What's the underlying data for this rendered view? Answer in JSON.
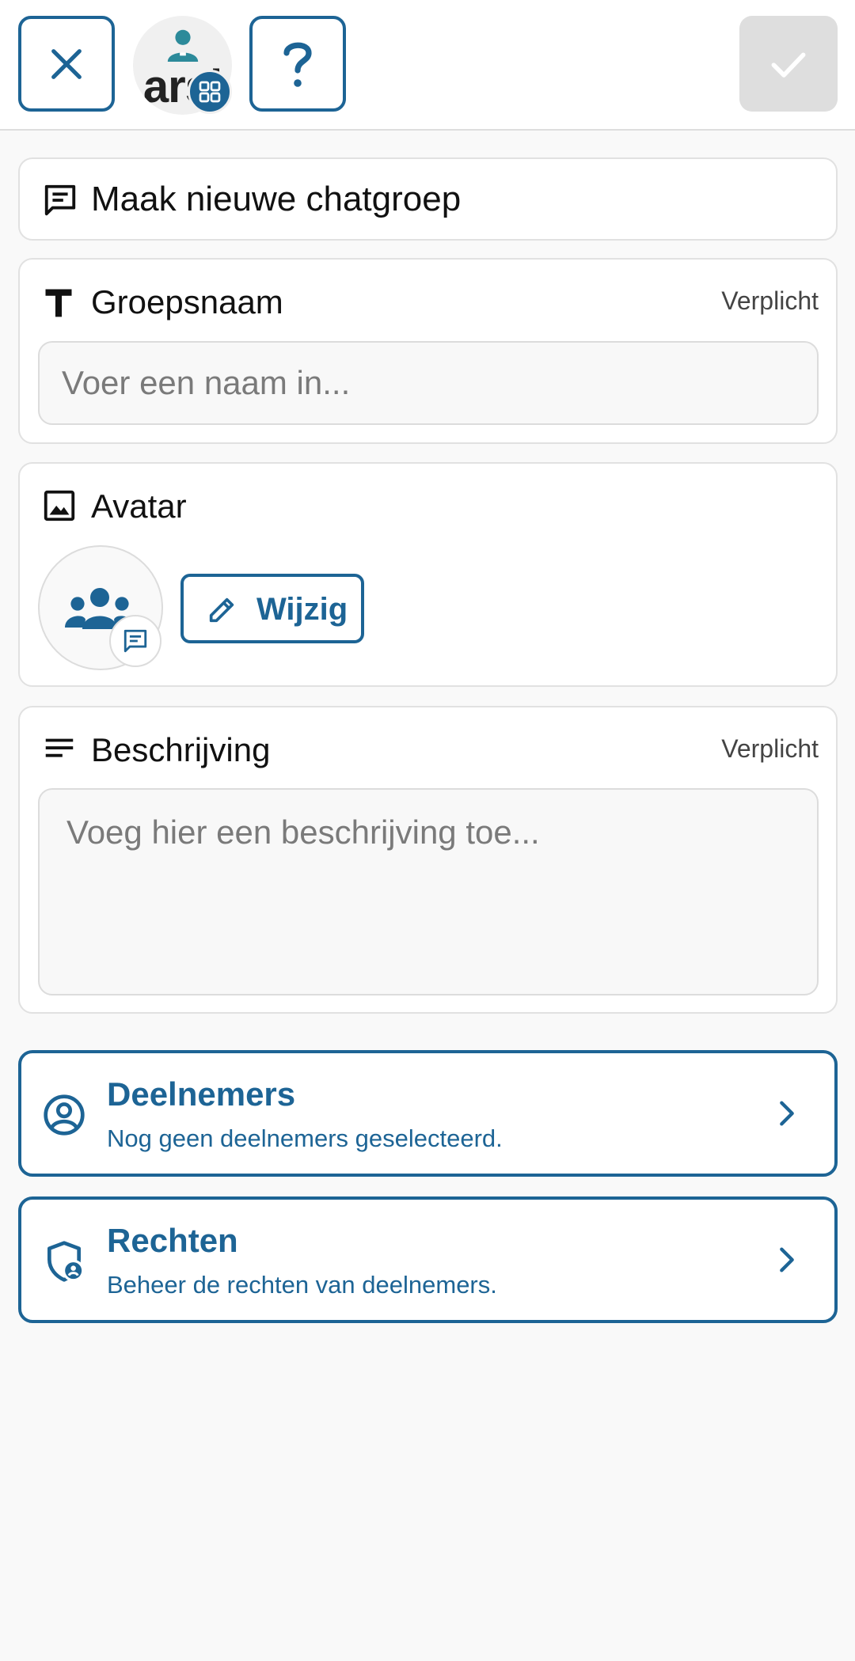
{
  "org": {
    "logo_text": "arsi"
  },
  "header": {
    "title": "Maak nieuwe chatgroep"
  },
  "group_name": {
    "label": "Groepsnaam",
    "required_label": "Verplicht",
    "placeholder": "Voer een naam in...",
    "value": ""
  },
  "avatar": {
    "label": "Avatar",
    "edit_label": "Wijzig"
  },
  "description": {
    "label": "Beschrijving",
    "required_label": "Verplicht",
    "placeholder": "Voeg hier een beschrijving toe...",
    "value": ""
  },
  "participants": {
    "title": "Deelnemers",
    "subtitle": "Nog geen deelnemers geselecteerd."
  },
  "rights": {
    "title": "Rechten",
    "subtitle": "Beheer de rechten van deelnemers."
  },
  "colors": {
    "accent": "#1d6495",
    "teal": "#2c8a9a",
    "disabled": "#dedede"
  }
}
